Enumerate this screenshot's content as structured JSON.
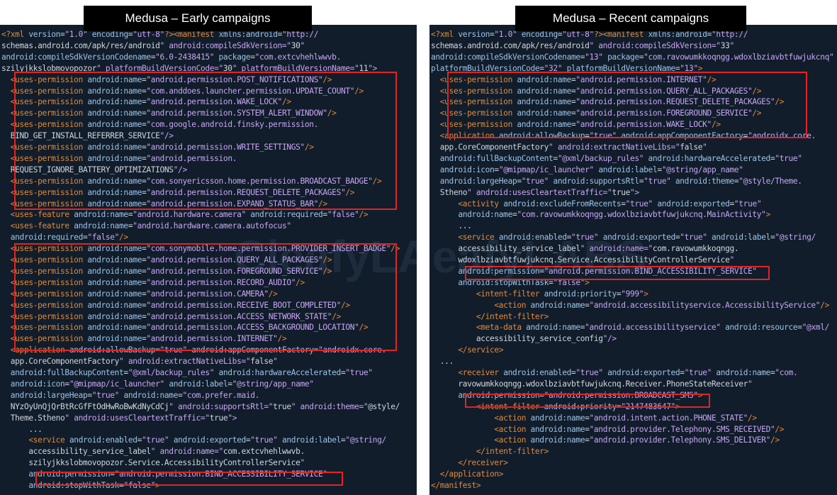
{
  "titles": {
    "left": "Medusa – Early campaigns",
    "right": "Medusa – Recent campaigns"
  },
  "left_lines": [
    "<?xml version=\"1.0\" encoding=\"utf-8\"?><manifest xmlns:android=\"http://",
    "schemas.android.com/apk/res/android\" android:compileSdkVersion=\"30\"",
    "android:compileSdkVersionCodename=\"6.0-2438415\" package=\"com.extcvhehlwwvb.",
    "szilyjkkslobmovopozor\" platformBuildVersionCode=\"30\" platformBuildVersionName=\"11\">",
    "  <uses-permission android:name=\"android.permission.POST_NOTIFICATIONS\"/>",
    "  <uses-permission android:name=\"com.anddoes.launcher.permission.UPDATE_COUNT\"/>",
    "  <uses-permission android:name=\"android.permission.WAKE_LOCK\"/>",
    "  <uses-permission android:name=\"android.permission.SYSTEM_ALERT_WINDOW\"/>",
    "  <uses-permission android:name=\"com.google.android.finsky.permission.",
    "  BIND_GET_INSTALL_REFERRER_SERVICE\"/>",
    "  <uses-permission android:name=\"android.permission.WRITE_SETTINGS\"/>",
    "  <uses-permission android:name=\"android.permission.",
    "  REQUEST_IGNORE_BATTERY_OPTIMIZATIONS\"/>",
    "  <uses-permission android:name=\"com.sonyericsson.home.permission.BROADCAST_BADGE\"/>",
    "  <uses-permission android:name=\"android.permission.REQUEST_DELETE_PACKAGES\"/>",
    "  <uses-permission android:name=\"android.permission.EXPAND_STATUS_BAR\"/>",
    "  <uses-feature android:name=\"android.hardware.camera\" android:required=\"false\"/>",
    "  <uses-feature android:name=\"android.hardware.camera.autofocus\"",
    "  android:required=\"false\"/>",
    "  <uses-permission android:name=\"com.sonymobile.home.permission.PROVIDER_INSERT_BADGE\"/>",
    "  <uses-permission android:name=\"android.permission.QUERY_ALL_PACKAGES\"/>",
    "  <uses-permission android:name=\"android.permission.FOREGROUND_SERVICE\"/>",
    "  <uses-permission android:name=\"android.permission.RECORD_AUDIO\"/>",
    "  <uses-permission android:name=\"android.permission.CAMERA\"/>",
    "  <uses-permission android:name=\"android.permission.RECEIVE_BOOT_COMPLETED\"/>",
    "  <uses-permission android:name=\"android.permission.ACCESS_NETWORK_STATE\"/>",
    "  <uses-permission android:name=\"android.permission.ACCESS_BACKGROUND_LOCATION\"/>",
    "  <uses-permission android:name=\"android.permission.INTERNET\"/>",
    "  <application android:allowBackup=\"true\" android:appComponentFactory=\"androidx.core.",
    "  app.CoreComponentFactory\" android:extractNativeLibs=\"false\"",
    "  android:fullBackupContent=\"@xml/backup_rules\" android:hardwareAccelerated=\"true\"",
    "  android:icon=\"@mipmap/ic_launcher\" android:label=\"@string/app_name\"",
    "  android:largeHeap=\"true\" android:name=\"com.prefer.maid.",
    "  NYzOyUnQjQrBtRcGfFtOdHwRoBwKdNyCdCj\" android:supportsRtl=\"true\" android:theme=\"@style/",
    "  Theme.Stheno\" android:usesCleartextTraffic=\"true\">",
    "      ...",
    "      <service android:enabled=\"true\" android:exported=\"true\" android:label=\"@string/",
    "      accessibility_service_label\" android:name=\"com.extcvhehlwwvb.",
    "      szilyjkkslobmovopozor.Service.AccessibilityControllerService\"",
    "      android:permission=\"android.permission.BIND_ACCESSIBILITY_SERVICE\"",
    "      android:stopWithTask=\"false\">"
  ],
  "right_lines": [
    "<?xml version=\"1.0\" encoding=\"utf-8\"?><manifest xmlns:android=\"http://",
    "schemas.android.com/apk/res/android\" android:compileSdkVersion=\"33\"",
    "android:compileSdkVersionCodename=\"13\" package=\"com.ravowumkkoqngg.wdoxlbziavbtfuwjukcnq\"",
    "platformBuildVersionCode=\"32\" platformBuildVersionName=\"13\">",
    "  <uses-permission android:name=\"android.permission.INTERNET\"/>",
    "  <uses-permission android:name=\"android.permission.QUERY_ALL_PACKAGES\"/>",
    "  <uses-permission android:name=\"android.permission.REQUEST_DELETE_PACKAGES\"/>",
    "  <uses-permission android:name=\"android.permission.FOREGROUND_SERVICE\"/>",
    "  <uses-permission android:name=\"android.permission.WAKE_LOCK\"/>",
    "  <application android:allowBackup=\"true\" android:appComponentFactory=\"androidx.core.",
    "  app.CoreComponentFactory\" android:extractNativeLibs=\"false\"",
    "  android:fullBackupContent=\"@xml/backup_rules\" android:hardwareAccelerated=\"true\"",
    "  android:icon=\"@mipmap/ic_launcher\" android:label=\"@string/app_name\"",
    "  android:largeHeap=\"true\" android:supportsRtl=\"true\" android:theme=\"@style/Theme.",
    "  Stheno\" android:usesCleartextTraffic=\"true\">",
    "      <activity android:excludeFromRecents=\"true\" android:exported=\"true\"",
    "      android:name=\"com.ravowumkkoqngg.wdoxlbziavbtfuwjukcnq.MainActivity\">",
    "      ...",
    "      <service android:enabled=\"true\" android:exported=\"true\" android:label=\"@string/",
    "      accessibility_service_label\" android:name=\"com.ravowumkkoqngg.",
    "      wdoxlbziavbtfuwjukcnq.Service.AccessibilityControllerService\"",
    "      android:permission=\"android.permission.BIND_ACCESSIBILITY_SERVICE\"",
    "      android:stopWithTask=\"false\">",
    "          <intent-filter android:priority=\"999\">",
    "              <action android:name=\"android.accessibilityservice.AccessibilityService\"/>",
    "          </intent-filter>",
    "          <meta-data android:name=\"android.accessibilityservice\" android:resource=\"@xml/",
    "          accessibility_service_config\"/>",
    "      </service>",
    "  ...",
    "      <receiver android:enabled=\"true\" android:exported=\"true\" android:name=\"com.",
    "      ravowumkkoqngg.wdoxlbziavbtfuwjukcnq.Receiver.PhoneStateReceiver\"",
    "      android:permission=\"android.permission.BROADCAST_SMS\">",
    "          <intent-filter android:priority=\"2147483647\">",
    "              <action android:name=\"android.intent.action.PHONE_STATE\"/>",
    "              <action android:name=\"android.provider.Telephony.SMS_RECEIVED\"/>",
    "              <action android:name=\"android.provider.Telephony.SMS_DELIVER\"/>",
    "          </intent-filter>",
    "      </receiver>",
    "  </application>",
    "</manifest>"
  ],
  "watermark": "CleafyLABS",
  "colors": {
    "background": "#111d2b",
    "tag": "#e08a3c",
    "attribute": "#9cc3e6",
    "value": "#c7a6f2",
    "highlight_box": "#e02525"
  }
}
